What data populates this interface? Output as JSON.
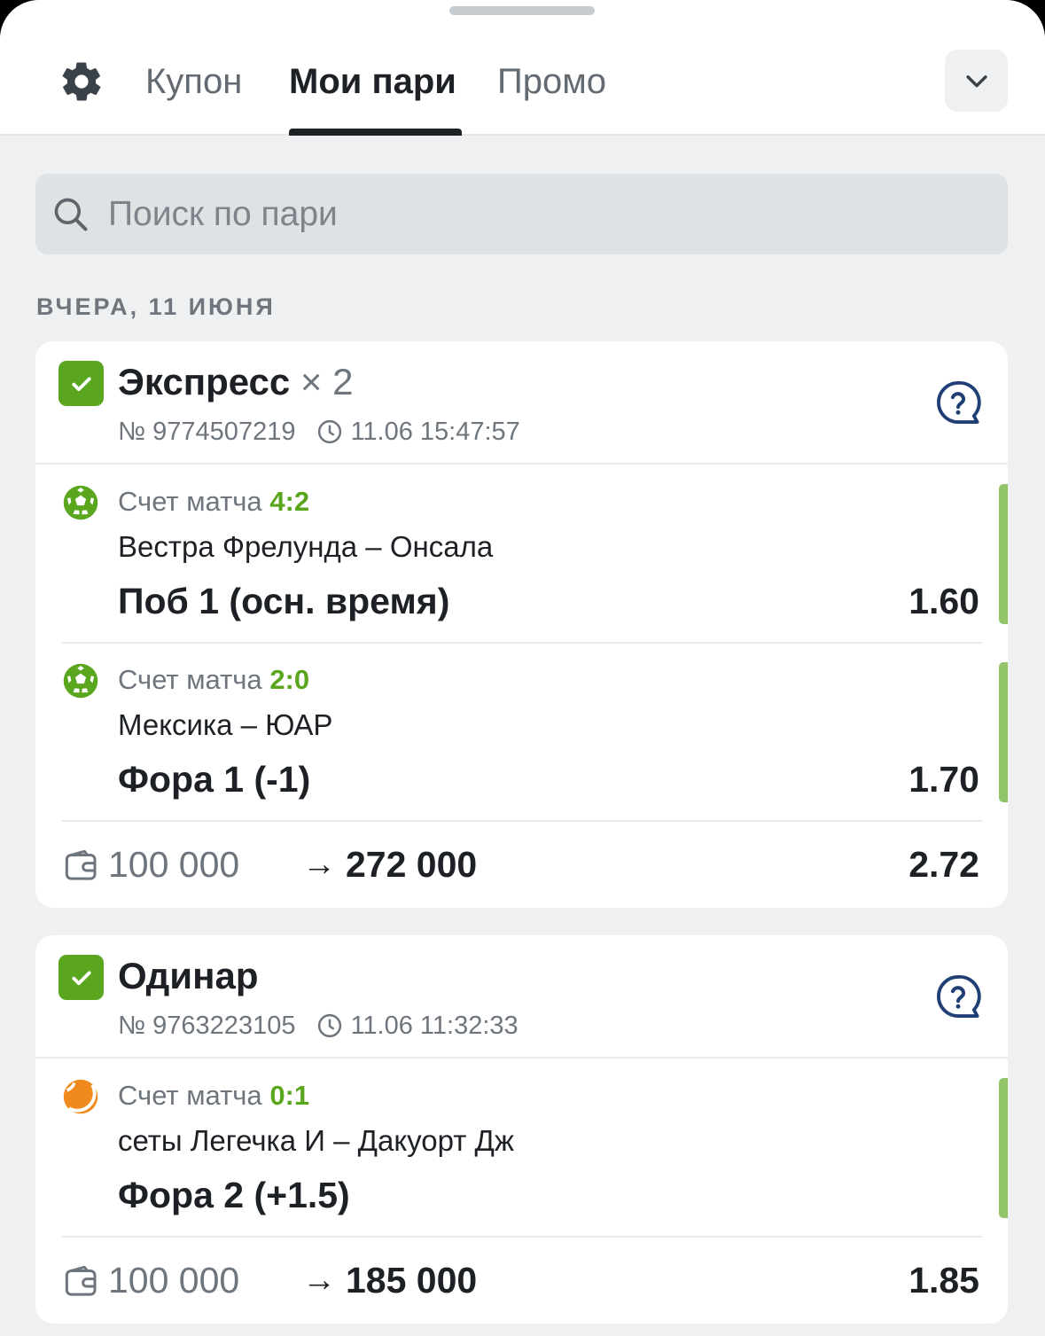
{
  "tabs": [
    {
      "label": "Купон",
      "active": false
    },
    {
      "label": "Мои пари",
      "active": true
    },
    {
      "label": "Промо",
      "active": false
    }
  ],
  "search": {
    "placeholder": "Поиск по пари"
  },
  "date_label": "ВЧЕРА, 11 ИЮНЯ",
  "colors": {
    "win": "#5aa61e",
    "win_bar": "#92c46a",
    "accent": "#1f3f75"
  },
  "bets": [
    {
      "type": "Экспресс",
      "multiplier": "× 2",
      "number": "№ 9774507219",
      "datetime": "11.06 15:47:57",
      "status": "won",
      "events": [
        {
          "sport_icon": "football-icon",
          "score_label": "Счет матча",
          "score": "4:2",
          "teams": "Вестра Фрелунда – Онсала",
          "market": "Поб 1 (осн. время)",
          "odds": "1.60"
        },
        {
          "sport_icon": "football-icon",
          "score_label": "Счет матча",
          "score": "2:0",
          "teams": "Мексика – ЮАР",
          "market": "Фора 1 (-1)",
          "odds": "1.70"
        }
      ],
      "stake": "100 000",
      "arrow": "→",
      "payout": "272 000",
      "total_odds": "2.72"
    },
    {
      "type": "Одинар",
      "multiplier": "",
      "number": "№ 9763223105",
      "datetime": "11.06 11:32:33",
      "status": "won",
      "events": [
        {
          "sport_icon": "tennis-icon",
          "score_label": "Счет матча",
          "score": "0:1",
          "teams": "сеты Легечка И – Дакуорт Дж",
          "market": "Фора 2 (+1.5)",
          "odds": ""
        }
      ],
      "stake": "100 000",
      "arrow": "→",
      "payout": "185 000",
      "total_odds": "1.85"
    }
  ]
}
